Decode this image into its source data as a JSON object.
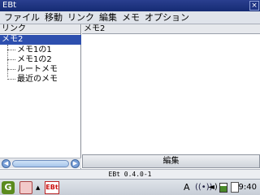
{
  "window": {
    "title": "EBt",
    "close_label": "×"
  },
  "menubar": {
    "items": [
      "ファイル",
      "移動",
      "リンク",
      "編集",
      "メモ",
      "オプション"
    ]
  },
  "left_pane": {
    "header": "リンク",
    "tree": {
      "root": "メモ2",
      "children": [
        "メモ1の1",
        "メモ1の2",
        "ルートメモ",
        "最近のメモ"
      ]
    },
    "scrollbar": {
      "left_arrow": "◀",
      "right_arrow": "▶"
    }
  },
  "right_pane": {
    "header": "メモ2",
    "edit_button": "編集"
  },
  "statusline": {
    "text": "EBt 0.4.0-1"
  },
  "taskbar": {
    "start_glyph": "G",
    "tray_arrow": "▲",
    "app_label": "EBt",
    "ime": "A",
    "wifi_glyph": "((•))",
    "volume_glyph": "◄)",
    "battery_level": 0.7,
    "clock": "9:40"
  },
  "colors": {
    "titlebar": "#1f3484",
    "selection": "#2d4fae",
    "menubar": "#dfe3ea"
  }
}
